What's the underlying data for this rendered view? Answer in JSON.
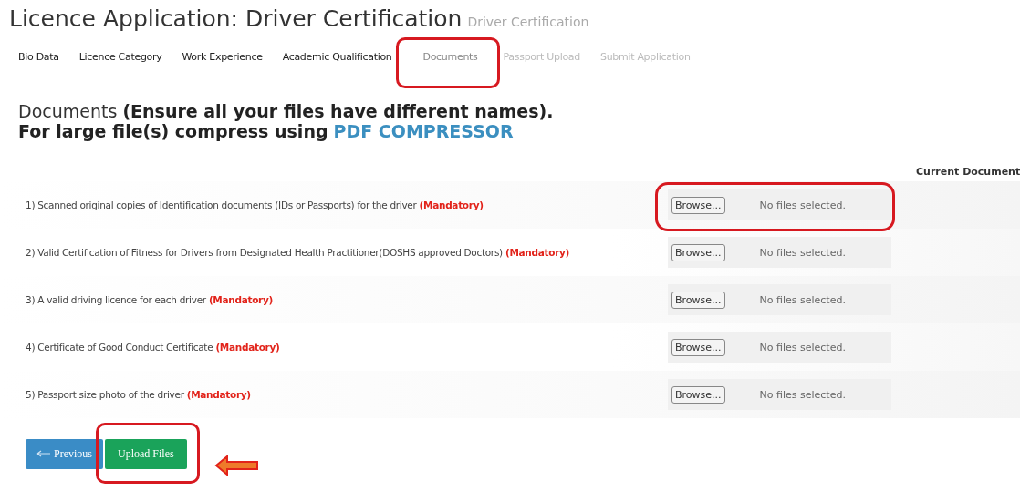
{
  "title": "Licence Application: Driver Certification",
  "subtitle": "Driver Certification",
  "tabs": [
    {
      "label": "Bio Data",
      "selected": false,
      "disabled": false,
      "highlighted": false
    },
    {
      "label": "Licence Category",
      "selected": false,
      "disabled": false,
      "highlighted": false
    },
    {
      "label": "Work Experience",
      "selected": false,
      "disabled": false,
      "highlighted": false
    },
    {
      "label": "Academic Qualification",
      "selected": false,
      "disabled": false,
      "highlighted": false
    },
    {
      "label": "Documents",
      "selected": true,
      "disabled": false,
      "highlighted": true
    },
    {
      "label": "Passport Upload",
      "selected": false,
      "disabled": true,
      "highlighted": false
    },
    {
      "label": "Submit Application",
      "selected": false,
      "disabled": true,
      "highlighted": false
    }
  ],
  "heading": {
    "lead": "Documents",
    "note": "(Ensure all your files have different names).",
    "line2": "For large file(s) compress using",
    "link": "PDF COMPRESSOR"
  },
  "current_document_header": "Current Document",
  "documents": [
    {
      "label": "1) Scanned original copies of Identification documents (IDs or Passports) for the driver",
      "required": "(Mandatory)",
      "browse": "Browse...",
      "status": "No files selected.",
      "highlighted": true
    },
    {
      "label": "2) Valid Certification of Fitness for Drivers from Designated Health Practitioner(DOSHS approved Doctors)",
      "required": "(Mandatory)",
      "browse": "Browse...",
      "status": "No files selected.",
      "highlighted": false
    },
    {
      "label": "3) A valid driving licence for each driver",
      "required": "(Mandatory)",
      "browse": "Browse...",
      "status": "No files selected.",
      "highlighted": false
    },
    {
      "label": "4) Certificate of Good Conduct Certificate",
      "required": "(Mandatory)",
      "browse": "Browse...",
      "status": "No files selected.",
      "highlighted": false
    },
    {
      "label": "5) Passport size photo of the driver",
      "required": "(Mandatory)",
      "browse": "Browse...",
      "status": "No files selected.",
      "highlighted": false
    }
  ],
  "buttons": [
    {
      "kind": "previous",
      "label": "Previous",
      "highlighted": false
    },
    {
      "kind": "upload",
      "label": "Upload Files",
      "highlighted": true
    }
  ],
  "pointer_arrow": true
}
